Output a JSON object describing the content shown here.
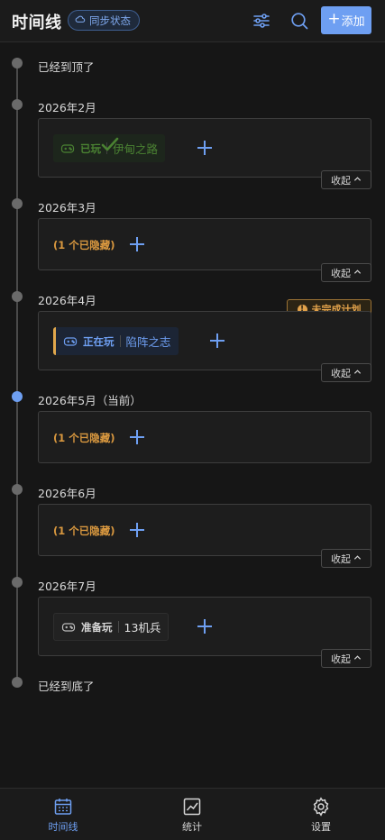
{
  "header": {
    "title": "时间线",
    "sync_label": "同步状态",
    "add_label": "添加",
    "filter_icon": "sliders-icon",
    "search_icon": "search-icon"
  },
  "timeline": {
    "top_label": "已经到顶了",
    "bottom_label": "已经到底了",
    "collapse_label": "收起",
    "months": [
      {
        "label": "2026年2月",
        "game": {
          "status": "已玩",
          "title": "伊甸之路"
        }
      },
      {
        "label": "2026年3月",
        "hidden_note": "(1 个已隐藏)"
      },
      {
        "label": "2026年4月",
        "warning": "未完成计划",
        "game": {
          "status": "正在玩",
          "title": "陷阵之志"
        }
      },
      {
        "label": "2026年5月（当前）",
        "hidden_note": "(1 个已隐藏)"
      },
      {
        "label": "2026年6月",
        "hidden_note": "(1 个已隐藏)"
      },
      {
        "label": "2026年7月",
        "game": {
          "status": "准备玩",
          "title": "13机兵"
        }
      }
    ]
  },
  "nav": {
    "items": [
      {
        "label": "时间线",
        "icon": "calendar-icon",
        "active": true
      },
      {
        "label": "统计",
        "icon": "chart-icon",
        "active": false
      },
      {
        "label": "设置",
        "icon": "gear-icon",
        "active": false
      }
    ]
  },
  "colors": {
    "accent": "#6e9ff2",
    "played": "#5aa43a",
    "playing": "#6e9ff2",
    "hidden": "#d9983f",
    "warning": "#e2a24b",
    "background": "#161616"
  }
}
